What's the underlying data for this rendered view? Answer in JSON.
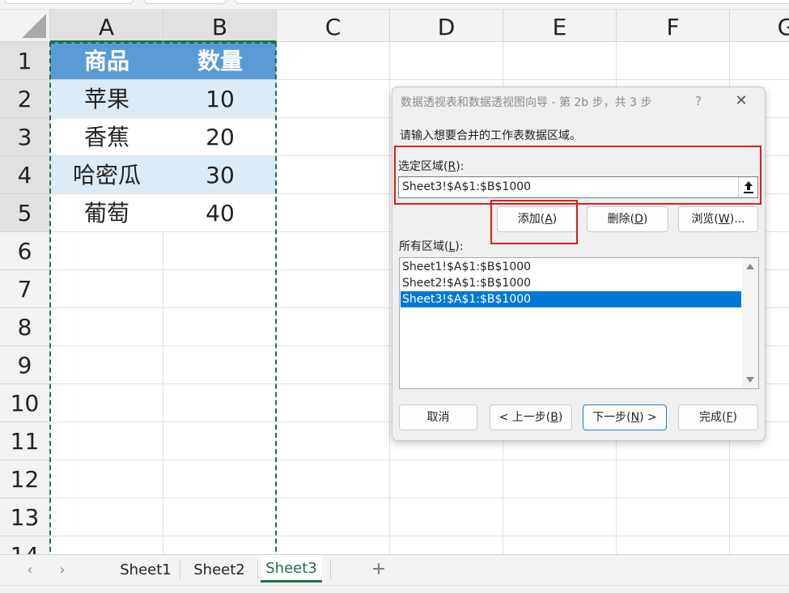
{
  "colors": {
    "header_fill": "#5b9bd5",
    "band_fill": "#ddebf7",
    "accent": "#1e7145",
    "annotation": "#e01b1b",
    "selection": "#0078d7"
  },
  "columns": [
    "A",
    "B",
    "C",
    "D",
    "E",
    "F",
    "G"
  ],
  "rows": [
    "1",
    "2",
    "3",
    "4",
    "5",
    "6",
    "7",
    "8",
    "9",
    "10",
    "11",
    "12",
    "13",
    "14"
  ],
  "table": {
    "headers": [
      "商品",
      "数量"
    ],
    "rows": [
      [
        "苹果",
        "10"
      ],
      [
        "香蕉",
        "20"
      ],
      [
        "哈密瓜",
        "30"
      ],
      [
        "葡萄",
        "40"
      ]
    ]
  },
  "tabs": {
    "prev_icon": "chevron-left-icon",
    "next_icon": "chevron-right-icon",
    "sheets": [
      "Sheet1",
      "Sheet2",
      "Sheet3"
    ],
    "active": "Sheet3",
    "add_icon": "plus-icon"
  },
  "dialog": {
    "title": "数据透视表和数据透视图向导 - 第 2b 步，共 3 步",
    "help": "?",
    "close_icon": "close-icon",
    "prompt": "请输入想要合并的工作表数据区域。",
    "range_label": "选定区域(",
    "range_key": "R",
    "range_suffix": "):",
    "range_value": "Sheet3!$A$1:$B$1000",
    "collapse_icon": "collapse-upload-icon",
    "add_label": "添加(",
    "add_key": "A",
    "add_suffix": ")",
    "delete_label": "删除(",
    "delete_key": "D",
    "delete_suffix": ")",
    "browse_label": "浏览(",
    "browse_key": "W",
    "browse_suffix": ")...",
    "all_label": "所有区域(",
    "all_key": "L",
    "all_suffix": "):",
    "ranges": [
      "Sheet1!$A$1:$B$1000",
      "Sheet2!$A$1:$B$1000",
      "Sheet3!$A$1:$B$1000"
    ],
    "selected_range": "Sheet3!$A$1:$B$1000",
    "cancel": "取消",
    "back_label": "< 上一步(",
    "back_key": "B",
    "back_suffix": ")",
    "next_label": "下一步(",
    "next_key": "N",
    "next_suffix": ") >",
    "finish_label": "完成(",
    "finish_key": "F",
    "finish_suffix": ")"
  }
}
